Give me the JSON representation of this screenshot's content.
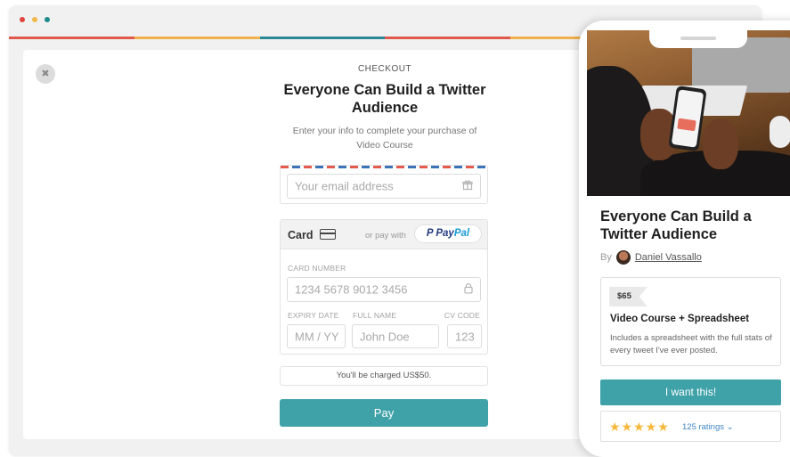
{
  "checkout": {
    "eyebrow": "CHECKOUT",
    "title": "Everyone Can Build a Twitter Audience",
    "subtitle": "Enter your info to complete your purchase of Video Course",
    "email_placeholder": "Your email address",
    "card_label": "Card",
    "or_pay_with": "or pay with",
    "paypal_p": "P",
    "paypal_pay": "Pay",
    "paypal_pal": "Pal",
    "card_number_label": "CARD NUMBER",
    "card_number_placeholder": "1234 5678 9012 3456",
    "expiry_label": "EXPIRY DATE",
    "expiry_placeholder": "MM / YY",
    "name_label": "FULL NAME",
    "name_placeholder": "John Doe",
    "cvc_label": "CV CODE",
    "cvc_placeholder": "123",
    "charge_note": "You'll be charged US$50.",
    "pay_button": "Pay"
  },
  "product": {
    "title": "Everyone Can Build a Twitter Audience",
    "by_label": "By",
    "author": "Daniel Vassallo",
    "price": "$65",
    "name": "Video Course + Spreadsheet",
    "description": "Includes a spreadsheet with the full stats of every tweet I've ever posted.",
    "cta": "I want this!",
    "stars": "★★★★★",
    "rating_count": "125 ratings ⌄"
  },
  "colors": {
    "accent": "#3fa2a8",
    "star": "#f5b83b",
    "link": "#3f86c4",
    "paypal_dark": "#253b80",
    "paypal_light": "#179bd7"
  },
  "icons": {
    "close": "close-icon",
    "email": "gift-icon",
    "card": "credit-card-icon",
    "lock": "lock-icon",
    "chevron": "chevron-down-icon"
  }
}
